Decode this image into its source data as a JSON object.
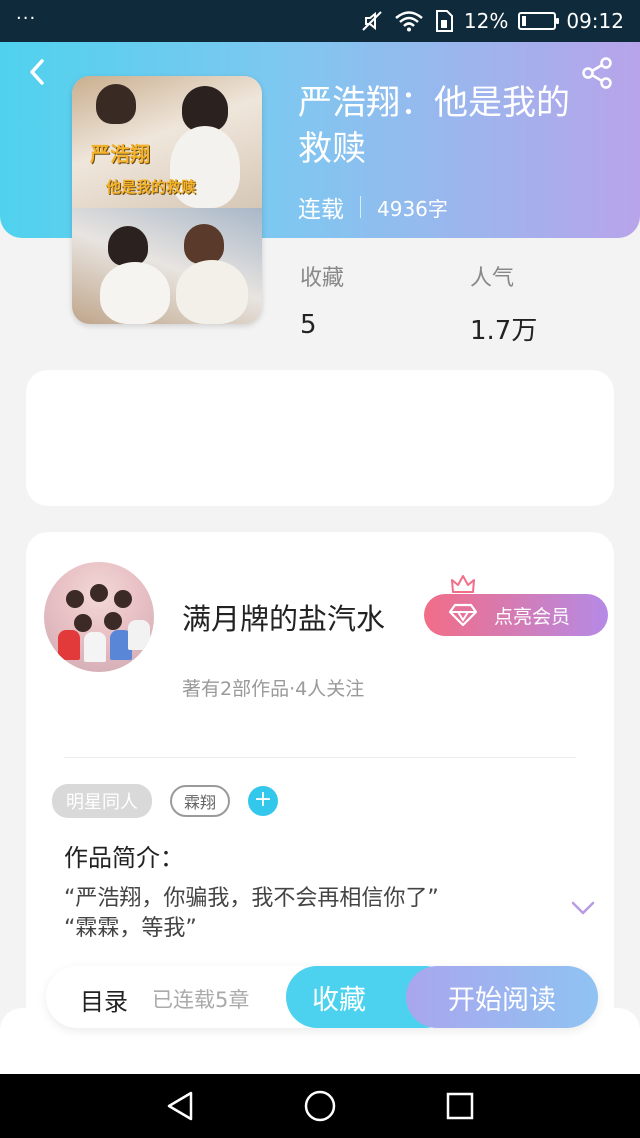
{
  "status_bar": {
    "menu_dots": "···",
    "battery_percent": "12%",
    "battery_level": 0.12,
    "time": "09:12"
  },
  "header": {
    "back_icon": "chevron-left-icon",
    "share_icon": "share-icon",
    "title": "严浩翔：他是我的救赎",
    "status": "连载",
    "word_count": "4936字",
    "cover": {
      "overlay_line1": "严浩翔",
      "overlay_line2": "他是我的救赎"
    }
  },
  "stats": {
    "favorites_label": "收藏",
    "favorites_value": "5",
    "popularity_label": "人气",
    "popularity_value": "1.7万"
  },
  "author": {
    "name": "满月牌的盐汽水",
    "vip_label": "点亮会员",
    "vip_icon": "diamond-icon",
    "crown_icon": "crown-icon",
    "stats": "著有2部作品·4人关注"
  },
  "tags": {
    "items": [
      "明星同人",
      "霖翔"
    ],
    "add_label": "+"
  },
  "intro": {
    "title": "作品简介：",
    "line1": "“严浩翔，你骗我，我不会再相信你了”",
    "line2": "“霖霖，等我”"
  },
  "action_bar": {
    "toc_label": "目录",
    "chapters_label": "已连载5章",
    "collect_label": "收藏",
    "read_label": "开始阅读"
  },
  "colors": {
    "header_gradient_start": "#4fd2ee",
    "header_gradient_end": "#b8a4ea",
    "accent_cyan": "#4cd2ef",
    "vip_pink": "#f26d86",
    "vip_purple": "#b58ae6"
  }
}
